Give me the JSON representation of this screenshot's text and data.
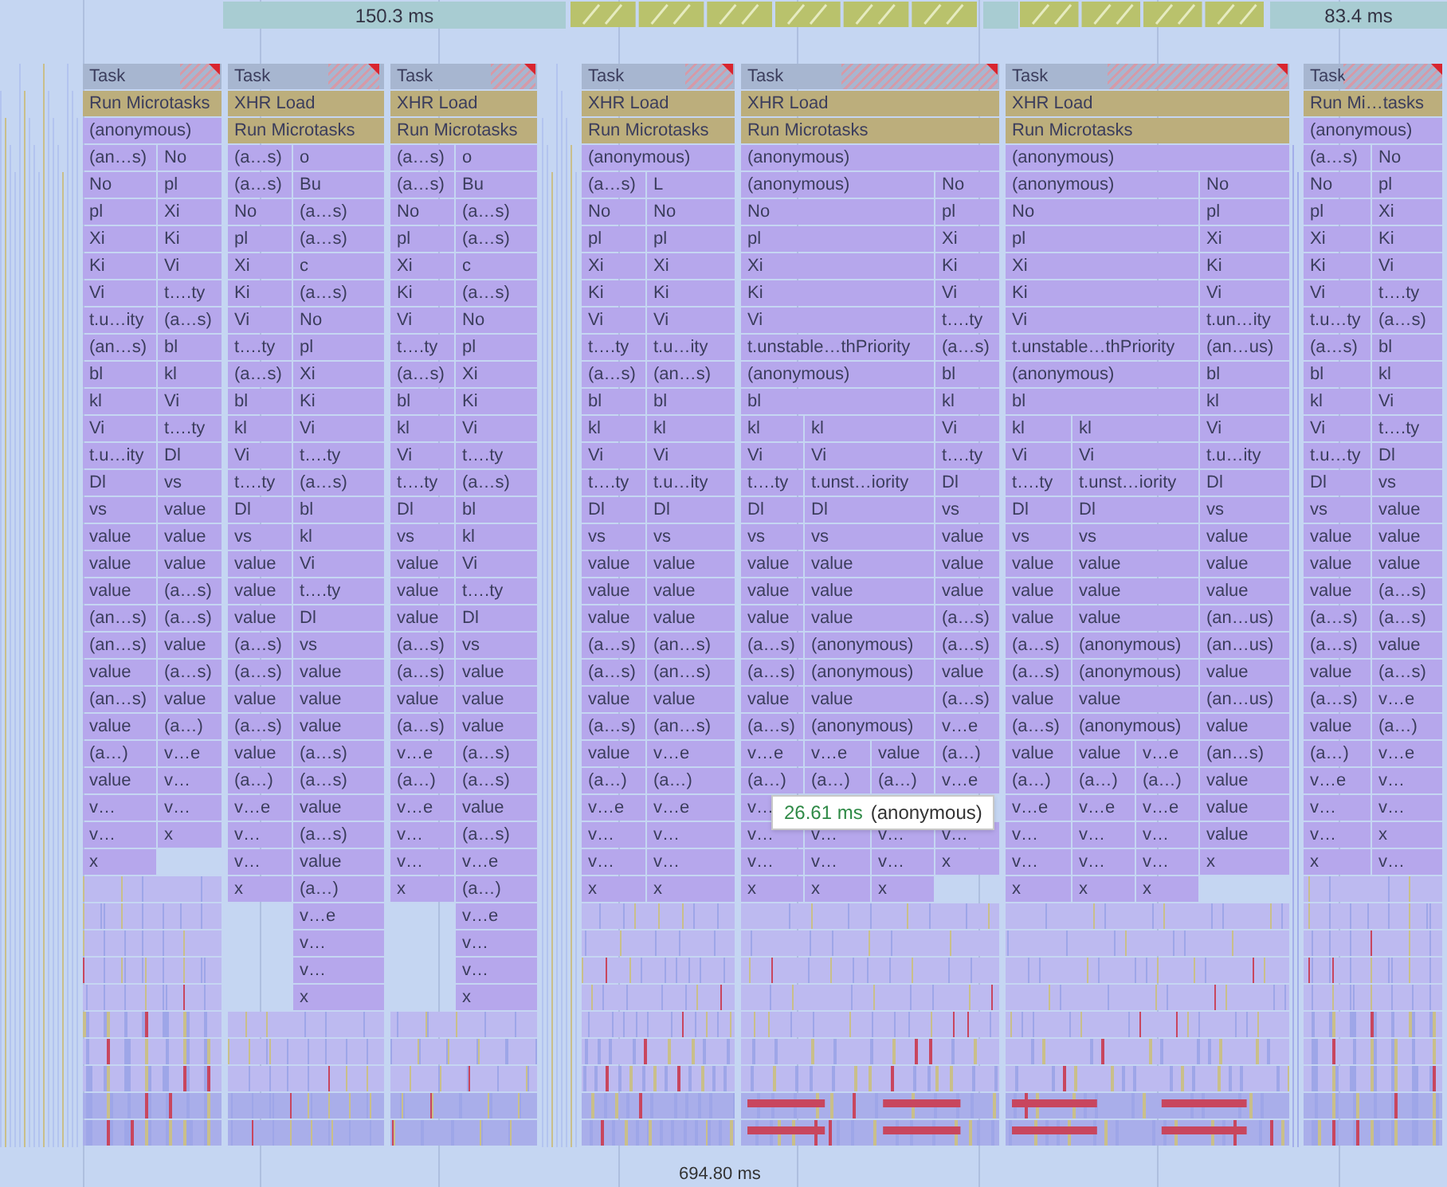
{
  "overview": {
    "labels": [
      "150.3 ms",
      "83.4 ms"
    ]
  },
  "tasks": [
    {
      "header": "Task",
      "events": [
        "Run Microtasks"
      ],
      "calls": [
        [
          "(anonymous)"
        ],
        [
          "(an…s)",
          "No"
        ],
        [
          "No",
          "pl"
        ],
        [
          "pl",
          "Xi"
        ],
        [
          "Xi",
          "Ki"
        ],
        [
          "Ki",
          "Vi"
        ],
        [
          "Vi",
          "t….ty"
        ],
        [
          "t.u…ity",
          "(a…s)"
        ],
        [
          "(an…s)",
          "bl"
        ],
        [
          "bl",
          "kl"
        ],
        [
          "kl",
          "Vi"
        ],
        [
          "Vi",
          "t….ty"
        ],
        [
          "t.u…ity",
          "Dl"
        ],
        [
          "Dl",
          "vs"
        ],
        [
          "vs",
          "value"
        ],
        [
          "value",
          "value"
        ],
        [
          "value",
          "value"
        ],
        [
          "value",
          "(a…s)"
        ],
        [
          "(an…s)",
          "(a…s)"
        ],
        [
          "(an…s)",
          "value"
        ],
        [
          "value",
          "(a…s)"
        ],
        [
          "(an…s)",
          "value"
        ],
        [
          "value",
          "(a…)"
        ],
        [
          "(a…)",
          "v…e"
        ],
        [
          "value",
          "v…"
        ],
        [
          "v…",
          "v…"
        ],
        [
          "v…",
          "x"
        ],
        {
          "cells": [
            "x"
          ],
          "trailing_gap": true
        }
      ]
    },
    {
      "header": "Task",
      "events": [
        "XHR Load",
        "Run Microtasks"
      ],
      "calls": [
        [
          "(a…s)",
          "o"
        ],
        [
          "(a…s)",
          "Bu"
        ],
        [
          "No",
          "(a…s)"
        ],
        [
          "pl",
          "(a…s)"
        ],
        [
          "Xi",
          "c"
        ],
        [
          "Ki",
          "(a…s)"
        ],
        [
          "Vi",
          "No"
        ],
        [
          "t….ty",
          "pl"
        ],
        [
          "(a…s)",
          "Xi"
        ],
        [
          "bl",
          "Ki"
        ],
        [
          "kl",
          "Vi"
        ],
        [
          "Vi",
          "t….ty"
        ],
        [
          "t….ty",
          "(a…s)"
        ],
        [
          "Dl",
          "bl"
        ],
        [
          "vs",
          "kl"
        ],
        [
          "value",
          "Vi"
        ],
        [
          "value",
          "t….ty"
        ],
        [
          "value",
          "Dl"
        ],
        [
          "(a…s)",
          "vs"
        ],
        [
          "(a…s)",
          "value"
        ],
        [
          "value",
          "value"
        ],
        [
          "(a…s)",
          "value"
        ],
        [
          "value",
          "(a…s)"
        ],
        [
          "(a…)",
          "(a…s)"
        ],
        [
          "v…e",
          "value"
        ],
        [
          "v…",
          "(a…s)"
        ],
        [
          "v…",
          "value"
        ],
        [
          "x",
          "(a…)"
        ],
        {
          "cells": [
            "v…e"
          ],
          "leading_gap": true
        },
        {
          "cells": [
            "v…"
          ],
          "leading_gap": true
        },
        {
          "cells": [
            "v…"
          ],
          "leading_gap": true
        },
        {
          "cells": [
            "x"
          ],
          "leading_gap": true
        }
      ]
    },
    {
      "header": "Task",
      "events": [
        "XHR Load",
        "Run Microtasks"
      ],
      "calls": [
        [
          "(a…s)",
          "o"
        ],
        [
          "(a…s)",
          "Bu"
        ],
        [
          "No",
          "(a…s)"
        ],
        [
          "pl",
          "(a…s)"
        ],
        [
          "Xi",
          "c"
        ],
        [
          "Ki",
          "(a…s)"
        ],
        [
          "Vi",
          "No"
        ],
        [
          "t….ty",
          "pl"
        ],
        [
          "(a…s)",
          "Xi"
        ],
        [
          "bl",
          "Ki"
        ],
        [
          "kl",
          "Vi"
        ],
        [
          "Vi",
          "t….ty"
        ],
        [
          "t….ty",
          "(a…s)"
        ],
        [
          "Dl",
          "bl"
        ],
        [
          "vs",
          "kl"
        ],
        [
          "value",
          "Vi"
        ],
        [
          "value",
          "t….ty"
        ],
        [
          "value",
          "Dl"
        ],
        [
          "(a…s)",
          "vs"
        ],
        [
          "(a…s)",
          "value"
        ],
        [
          "value",
          "value"
        ],
        [
          "(a…s)",
          "value"
        ],
        [
          "v…e",
          "(a…s)"
        ],
        [
          "(a…)",
          "(a…s)"
        ],
        [
          "v…e",
          "value"
        ],
        [
          "v…",
          "(a…s)"
        ],
        [
          "v…",
          "v…e"
        ],
        [
          "x",
          "(a…)"
        ],
        {
          "cells": [
            "v…e"
          ],
          "leading_gap": true
        },
        {
          "cells": [
            "v…"
          ],
          "leading_gap": true
        },
        {
          "cells": [
            "v…"
          ],
          "leading_gap": true
        },
        {
          "cells": [
            "x"
          ],
          "leading_gap": true
        }
      ]
    },
    {
      "header": "Task",
      "events": [
        "XHR Load",
        "Run Microtasks"
      ],
      "calls": [
        [
          "(anonymous)"
        ],
        [
          "(a…s)",
          "L"
        ],
        [
          "No",
          "No"
        ],
        [
          "pl",
          "pl"
        ],
        [
          "Xi",
          "Xi"
        ],
        [
          "Ki",
          "Ki"
        ],
        [
          "Vi",
          "Vi"
        ],
        [
          "t….ty",
          "t.u…ity"
        ],
        [
          "(a…s)",
          "(an…s)"
        ],
        [
          "bl",
          "bl"
        ],
        [
          "kl",
          "kl"
        ],
        [
          "Vi",
          "Vi"
        ],
        [
          "t….ty",
          "t.u…ity"
        ],
        [
          "Dl",
          "Dl"
        ],
        [
          "vs",
          "vs"
        ],
        [
          "value",
          "value"
        ],
        [
          "value",
          "value"
        ],
        [
          "value",
          "value"
        ],
        [
          "(a…s)",
          "(an…s)"
        ],
        [
          "(a…s)",
          "(an…s)"
        ],
        [
          "value",
          "value"
        ],
        [
          "(a…s)",
          "(an…s)"
        ],
        [
          "value",
          "v…e"
        ],
        [
          "(a…)",
          "(a…)"
        ],
        [
          "v…e",
          "v…e"
        ],
        [
          "v…",
          "v…"
        ],
        [
          "v…",
          "v…"
        ],
        [
          "x",
          "x"
        ]
      ]
    },
    {
      "header": "Task",
      "events": [
        "XHR Load",
        "Run Microtasks"
      ],
      "calls": [
        [
          "(anonymous)"
        ],
        [
          "(anonymous)",
          "No"
        ],
        [
          "No",
          "pl"
        ],
        [
          "pl",
          "Xi"
        ],
        [
          "Xi",
          "Ki"
        ],
        [
          "Ki",
          "Vi"
        ],
        [
          "Vi",
          "t….ty"
        ],
        [
          "t.unstable…thPriority",
          "(a…s)"
        ],
        [
          "(anonymous)",
          "bl"
        ],
        [
          "bl",
          "kl"
        ],
        [
          "kl",
          "kl",
          "Vi"
        ],
        [
          "Vi",
          "Vi",
          "t….ty"
        ],
        [
          "t….ty",
          "t.unst…iority",
          "Dl"
        ],
        [
          "Dl",
          "Dl",
          "vs"
        ],
        [
          "vs",
          "vs",
          "value"
        ],
        [
          "value",
          "value",
          "value"
        ],
        [
          "value",
          "value",
          "value"
        ],
        [
          "value",
          "value",
          "(a…s)"
        ],
        [
          "(a…s)",
          "(anonymous)",
          "(a…s)"
        ],
        [
          "(a…s)",
          "(anonymous)",
          "value"
        ],
        [
          "value",
          "value",
          "(a…s)"
        ],
        [
          "(a…s)",
          "(anonymous)",
          "v…e"
        ],
        [
          "v…e",
          "v…e",
          "value",
          "(a…)"
        ],
        [
          "(a…)",
          "(a…)",
          "(a…)",
          "v…e"
        ],
        {
          "cells": [
            "v…"
          ],
          "trailing_gap": true
        },
        [
          "v…",
          "v…",
          "v…",
          "v…"
        ],
        [
          "v…",
          "v…",
          "v…",
          "x"
        ],
        {
          "cells": [
            "x",
            "x",
            "x"
          ],
          "trailing_gap": true
        }
      ]
    },
    {
      "header": "Task",
      "events": [
        "XHR Load",
        "Run Microtasks"
      ],
      "calls": [
        [
          "(anonymous)"
        ],
        [
          "(anonymous)",
          "No"
        ],
        [
          "No",
          "pl"
        ],
        [
          "pl",
          "Xi"
        ],
        [
          "Xi",
          "Ki"
        ],
        [
          "Ki",
          "Vi"
        ],
        [
          "Vi",
          "t.un…ity"
        ],
        [
          "t.unstable…thPriority",
          "(an…us)"
        ],
        [
          "(anonymous)",
          "bl"
        ],
        [
          "bl",
          "kl"
        ],
        [
          "kl",
          "kl",
          "Vi"
        ],
        [
          "Vi",
          "Vi",
          "t.u…ity"
        ],
        [
          "t….ty",
          "t.unst…iority",
          "Dl"
        ],
        [
          "Dl",
          "Dl",
          "vs"
        ],
        [
          "vs",
          "vs",
          "value"
        ],
        [
          "value",
          "value",
          "value"
        ],
        [
          "value",
          "value",
          "value"
        ],
        [
          "value",
          "value",
          "(an…us)"
        ],
        [
          "(a…s)",
          "(anonymous)",
          "(an…us)"
        ],
        [
          "(a…s)",
          "(anonymous)",
          "value"
        ],
        [
          "value",
          "value",
          "(an…us)"
        ],
        [
          "(a…s)",
          "(anonymous)",
          "value"
        ],
        [
          "value",
          "value",
          "v…e",
          "(an…s)"
        ],
        [
          "(a…)",
          "(a…)",
          "(a…)",
          "value"
        ],
        [
          "v…e",
          "v…e",
          "v…e",
          "value"
        ],
        [
          "v…",
          "v…",
          "v…",
          "value"
        ],
        [
          "v…",
          "v…",
          "v…",
          "x"
        ],
        {
          "cells": [
            "x",
            "x",
            "x"
          ],
          "trailing_gap": true
        }
      ]
    },
    {
      "header": "Task",
      "events": [
        "Run Mi…tasks"
      ],
      "calls": [
        [
          "(anonymous)"
        ],
        [
          "(a…s)",
          "No"
        ],
        [
          "No",
          "pl"
        ],
        [
          "pl",
          "Xi"
        ],
        [
          "Xi",
          "Ki"
        ],
        [
          "Ki",
          "Vi"
        ],
        [
          "Vi",
          "t….ty"
        ],
        [
          "t.u…ty",
          "(a…s)"
        ],
        [
          "(a…s)",
          "bl"
        ],
        [
          "bl",
          "kl"
        ],
        [
          "kl",
          "Vi"
        ],
        [
          "Vi",
          "t….ty"
        ],
        [
          "t.u…ty",
          "Dl"
        ],
        [
          "Dl",
          "vs"
        ],
        [
          "vs",
          "value"
        ],
        [
          "value",
          "value"
        ],
        [
          "value",
          "value"
        ],
        [
          "value",
          "(a…s)"
        ],
        [
          "(a…s)",
          "(a…s)"
        ],
        [
          "(a…s)",
          "value"
        ],
        [
          "value",
          "(a…s)"
        ],
        [
          "(a…s)",
          "v…e"
        ],
        [
          "value",
          "(a…)"
        ],
        [
          "(a…)",
          "v…e"
        ],
        [
          "v…e",
          "v…"
        ],
        [
          "v…",
          "v…"
        ],
        [
          "v…",
          "x"
        ],
        [
          "x",
          "v…"
        ]
      ]
    }
  ],
  "tooltip": {
    "duration": "26.61 ms",
    "name": "(anonymous)"
  },
  "footer": "694.80 ms"
}
